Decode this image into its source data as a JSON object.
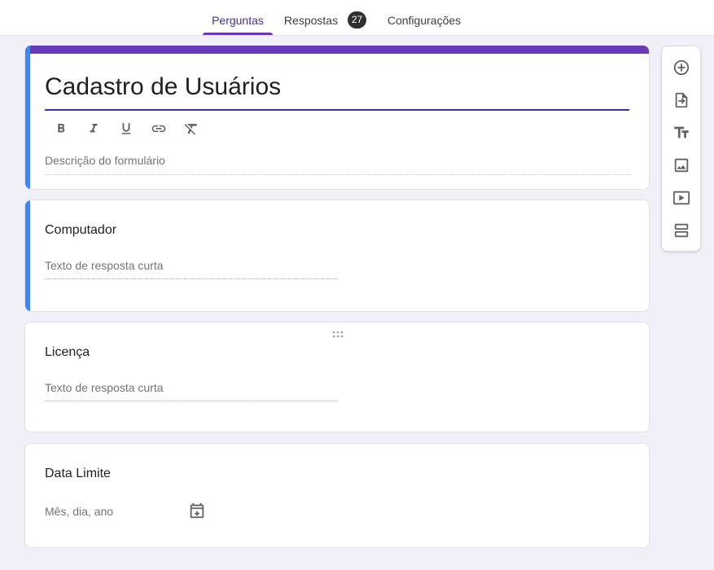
{
  "tabs": {
    "questions_label": "Perguntas",
    "responses_label": "Respostas",
    "responses_count": "27",
    "settings_label": "Configurações"
  },
  "form": {
    "title": "Cadastro de Usuários",
    "description_placeholder": "Descrição do formulário"
  },
  "formatting_icons": [
    "bold-icon",
    "italic-icon",
    "underline-icon",
    "link-icon",
    "clear-format-icon"
  ],
  "questions": [
    {
      "title": "Computador",
      "answer_placeholder": "Texto de resposta curta"
    },
    {
      "title": "Licença",
      "answer_placeholder": "Texto de resposta curta"
    },
    {
      "title": "Data Limite",
      "answer_placeholder": "Mês, dia, ano"
    }
  ],
  "toolbox_icons": [
    "add-question-icon",
    "import-questions-icon",
    "add-title-icon",
    "add-image-icon",
    "add-video-icon",
    "add-section-icon"
  ],
  "colors": {
    "accent": "#673ab7",
    "focus_bar": "#4285f4",
    "background": "#f1eff7"
  }
}
